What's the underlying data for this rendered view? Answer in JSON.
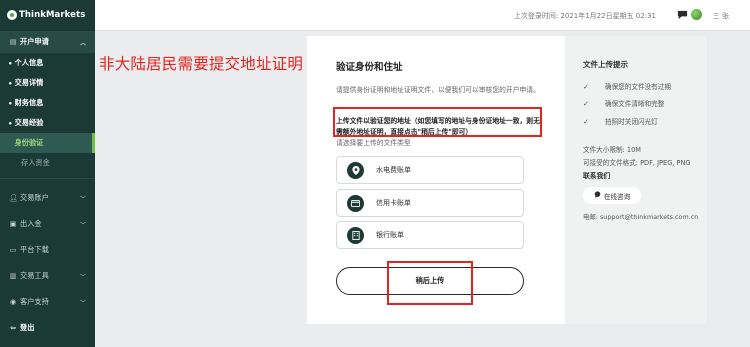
{
  "brand": {
    "logo_text": "ThinkMarkets"
  },
  "header": {
    "last_login": "上次登录时间: 2021年1月22日星期五 02:31",
    "user_name": "三 张"
  },
  "sidebar": {
    "section": "开户申请",
    "sub_items": [
      {
        "label": "个人信息"
      },
      {
        "label": "交易详情"
      },
      {
        "label": "财务信息"
      },
      {
        "label": "交易经验"
      },
      {
        "label": "身份验证"
      },
      {
        "label": "存入资金"
      }
    ],
    "items": [
      {
        "label": "交易账户"
      },
      {
        "label": "出入金"
      },
      {
        "label": "平台下载"
      },
      {
        "label": "交易工具"
      },
      {
        "label": "客户支持"
      },
      {
        "label": "登出"
      }
    ]
  },
  "annotation": {
    "red_note": "非大陆居民需要提交地址证明"
  },
  "card": {
    "title": "验证身份和住址",
    "description": "请提供身份证明和地址证明文件，以便我们可以审核您的开户申请。",
    "bold_note": "上传文件以验证您的地址（如您填写的地址与身份证地址一致，则无需额外地址证明，直接点击\"稍后上传\"即可）",
    "choose_prompt": "请选择要上传的文件类型",
    "options": [
      {
        "label": "水电费账单",
        "icon": "location-pin-icon"
      },
      {
        "label": "信用卡账单",
        "icon": "credit-card-icon"
      },
      {
        "label": "银行账单",
        "icon": "bank-icon"
      }
    ],
    "upload_later": "稍后上传"
  },
  "tips": {
    "title": "文件上传提示",
    "items": [
      "确保您的文件没有过期",
      "确保文件清晰和完整",
      "拍照时关闭闪光灯"
    ],
    "max_size": "文件大小限制: 10M",
    "formats": "可接受的文件格式: PDF, JPEG, PNG",
    "contact": "联系我们",
    "chat_button": "在线咨询",
    "email": "电邮: support@thinkmarkets.com.cn"
  },
  "colors": {
    "sidebar_bg": "#1b3a36",
    "active_accent": "#6fbf44",
    "annotation_red": "#e5231f"
  }
}
